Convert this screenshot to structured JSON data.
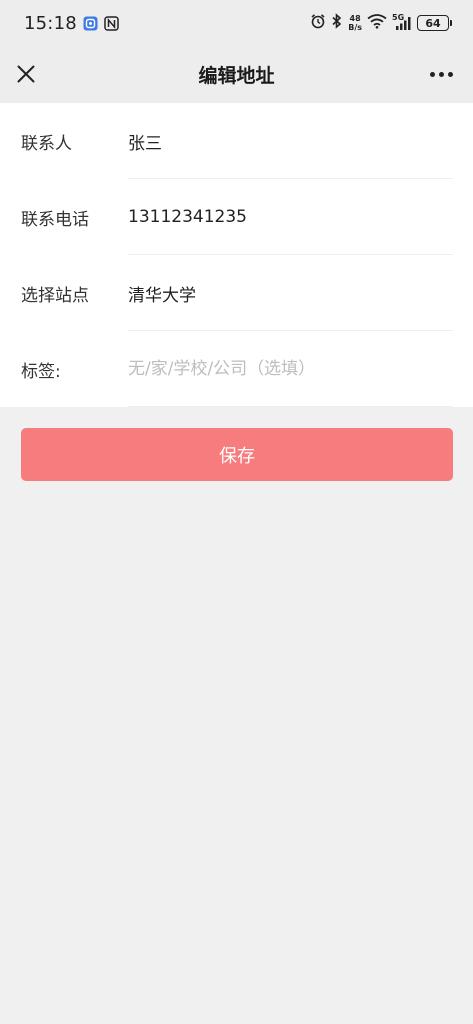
{
  "status_bar": {
    "time": "15:18",
    "net_speed_value": "48",
    "net_speed_unit": "B/s",
    "signal_label": "5G",
    "battery": "64",
    "icons": [
      "app-notification-icon",
      "nfc-icon",
      "alarm-icon",
      "bluetooth-icon",
      "wifi-icon",
      "cellular-signal-icon",
      "battery-icon"
    ]
  },
  "nav": {
    "title": "编辑地址",
    "close_icon": "close-icon",
    "more_icon": "more-icon"
  },
  "form": {
    "contact": {
      "label": "联系人",
      "value": "张三"
    },
    "phone": {
      "label": "联系电话",
      "value": "13112341235"
    },
    "site": {
      "label": "选择站点",
      "value": "清华大学"
    },
    "tag": {
      "label": "标签:",
      "value": "",
      "placeholder": "无/家/学校/公司（选填）"
    }
  },
  "actions": {
    "save_label": "保存"
  },
  "colors": {
    "accent": "#f77c7d",
    "background": "#f0f0f0",
    "header": "#ededed"
  }
}
